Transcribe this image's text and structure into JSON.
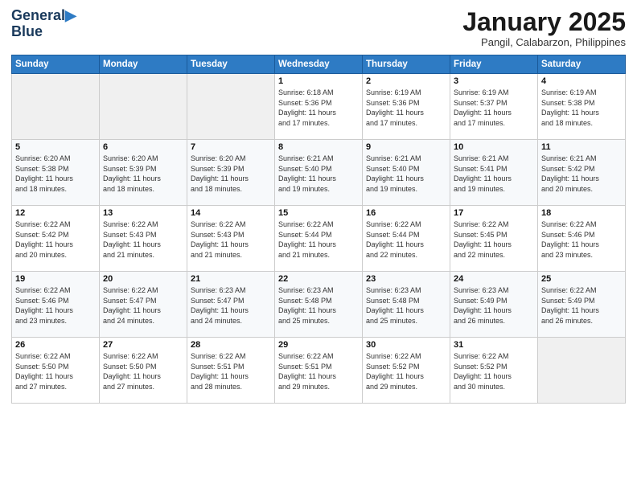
{
  "logo": {
    "line1": "General",
    "line2": "Blue"
  },
  "title": "January 2025",
  "subtitle": "Pangil, Calabarzon, Philippines",
  "weekdays": [
    "Sunday",
    "Monday",
    "Tuesday",
    "Wednesday",
    "Thursday",
    "Friday",
    "Saturday"
  ],
  "weeks": [
    [
      {
        "day": "",
        "info": ""
      },
      {
        "day": "",
        "info": ""
      },
      {
        "day": "",
        "info": ""
      },
      {
        "day": "1",
        "info": "Sunrise: 6:18 AM\nSunset: 5:36 PM\nDaylight: 11 hours\nand 17 minutes."
      },
      {
        "day": "2",
        "info": "Sunrise: 6:19 AM\nSunset: 5:36 PM\nDaylight: 11 hours\nand 17 minutes."
      },
      {
        "day": "3",
        "info": "Sunrise: 6:19 AM\nSunset: 5:37 PM\nDaylight: 11 hours\nand 17 minutes."
      },
      {
        "day": "4",
        "info": "Sunrise: 6:19 AM\nSunset: 5:38 PM\nDaylight: 11 hours\nand 18 minutes."
      }
    ],
    [
      {
        "day": "5",
        "info": "Sunrise: 6:20 AM\nSunset: 5:38 PM\nDaylight: 11 hours\nand 18 minutes."
      },
      {
        "day": "6",
        "info": "Sunrise: 6:20 AM\nSunset: 5:39 PM\nDaylight: 11 hours\nand 18 minutes."
      },
      {
        "day": "7",
        "info": "Sunrise: 6:20 AM\nSunset: 5:39 PM\nDaylight: 11 hours\nand 18 minutes."
      },
      {
        "day": "8",
        "info": "Sunrise: 6:21 AM\nSunset: 5:40 PM\nDaylight: 11 hours\nand 19 minutes."
      },
      {
        "day": "9",
        "info": "Sunrise: 6:21 AM\nSunset: 5:40 PM\nDaylight: 11 hours\nand 19 minutes."
      },
      {
        "day": "10",
        "info": "Sunrise: 6:21 AM\nSunset: 5:41 PM\nDaylight: 11 hours\nand 19 minutes."
      },
      {
        "day": "11",
        "info": "Sunrise: 6:21 AM\nSunset: 5:42 PM\nDaylight: 11 hours\nand 20 minutes."
      }
    ],
    [
      {
        "day": "12",
        "info": "Sunrise: 6:22 AM\nSunset: 5:42 PM\nDaylight: 11 hours\nand 20 minutes."
      },
      {
        "day": "13",
        "info": "Sunrise: 6:22 AM\nSunset: 5:43 PM\nDaylight: 11 hours\nand 21 minutes."
      },
      {
        "day": "14",
        "info": "Sunrise: 6:22 AM\nSunset: 5:43 PM\nDaylight: 11 hours\nand 21 minutes."
      },
      {
        "day": "15",
        "info": "Sunrise: 6:22 AM\nSunset: 5:44 PM\nDaylight: 11 hours\nand 21 minutes."
      },
      {
        "day": "16",
        "info": "Sunrise: 6:22 AM\nSunset: 5:44 PM\nDaylight: 11 hours\nand 22 minutes."
      },
      {
        "day": "17",
        "info": "Sunrise: 6:22 AM\nSunset: 5:45 PM\nDaylight: 11 hours\nand 22 minutes."
      },
      {
        "day": "18",
        "info": "Sunrise: 6:22 AM\nSunset: 5:46 PM\nDaylight: 11 hours\nand 23 minutes."
      }
    ],
    [
      {
        "day": "19",
        "info": "Sunrise: 6:22 AM\nSunset: 5:46 PM\nDaylight: 11 hours\nand 23 minutes."
      },
      {
        "day": "20",
        "info": "Sunrise: 6:22 AM\nSunset: 5:47 PM\nDaylight: 11 hours\nand 24 minutes."
      },
      {
        "day": "21",
        "info": "Sunrise: 6:23 AM\nSunset: 5:47 PM\nDaylight: 11 hours\nand 24 minutes."
      },
      {
        "day": "22",
        "info": "Sunrise: 6:23 AM\nSunset: 5:48 PM\nDaylight: 11 hours\nand 25 minutes."
      },
      {
        "day": "23",
        "info": "Sunrise: 6:23 AM\nSunset: 5:48 PM\nDaylight: 11 hours\nand 25 minutes."
      },
      {
        "day": "24",
        "info": "Sunrise: 6:23 AM\nSunset: 5:49 PM\nDaylight: 11 hours\nand 26 minutes."
      },
      {
        "day": "25",
        "info": "Sunrise: 6:22 AM\nSunset: 5:49 PM\nDaylight: 11 hours\nand 26 minutes."
      }
    ],
    [
      {
        "day": "26",
        "info": "Sunrise: 6:22 AM\nSunset: 5:50 PM\nDaylight: 11 hours\nand 27 minutes."
      },
      {
        "day": "27",
        "info": "Sunrise: 6:22 AM\nSunset: 5:50 PM\nDaylight: 11 hours\nand 27 minutes."
      },
      {
        "day": "28",
        "info": "Sunrise: 6:22 AM\nSunset: 5:51 PM\nDaylight: 11 hours\nand 28 minutes."
      },
      {
        "day": "29",
        "info": "Sunrise: 6:22 AM\nSunset: 5:51 PM\nDaylight: 11 hours\nand 29 minutes."
      },
      {
        "day": "30",
        "info": "Sunrise: 6:22 AM\nSunset: 5:52 PM\nDaylight: 11 hours\nand 29 minutes."
      },
      {
        "day": "31",
        "info": "Sunrise: 6:22 AM\nSunset: 5:52 PM\nDaylight: 11 hours\nand 30 minutes."
      },
      {
        "day": "",
        "info": ""
      }
    ]
  ]
}
